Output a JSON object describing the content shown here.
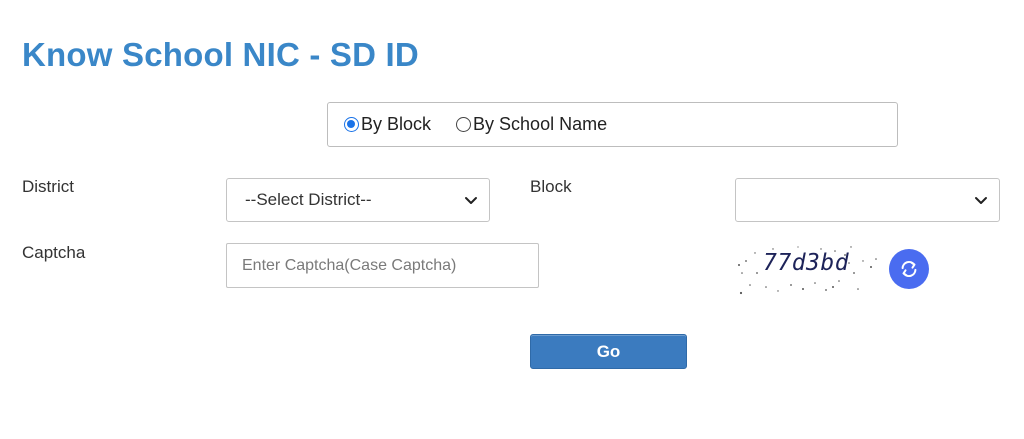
{
  "page": {
    "title": "Know School NIC - SD ID"
  },
  "search_mode": {
    "options": [
      {
        "label": "By Block",
        "checked": true
      },
      {
        "label": "By School Name",
        "checked": false
      }
    ]
  },
  "form": {
    "district": {
      "label": "District",
      "selected": "--Select District--"
    },
    "block": {
      "label": "Block",
      "selected": ""
    },
    "captcha": {
      "label": "Captcha",
      "value": "",
      "placeholder": "Enter Captcha(Case Captcha)",
      "image_text": "77d3bd",
      "refresh_icon": "refresh-icon"
    }
  },
  "actions": {
    "go_label": "Go"
  },
  "colors": {
    "title": "#3a87c8",
    "go_button": "#3b7bbf",
    "refresh_button": "#4a6cf0",
    "radio_checked": "#1a73e8"
  }
}
